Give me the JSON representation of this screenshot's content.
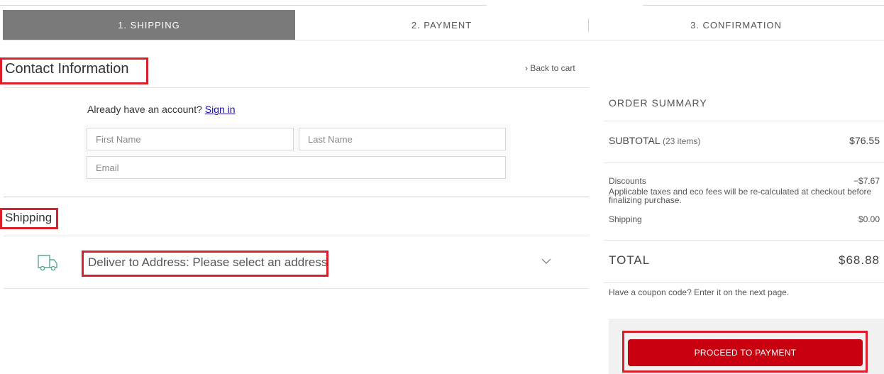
{
  "steps": [
    {
      "label": "1. SHIPPING",
      "active": true
    },
    {
      "label": "2. PAYMENT",
      "active": false
    },
    {
      "label": "3. CONFIRMATION",
      "active": false
    }
  ],
  "contact": {
    "title": "Contact Information",
    "back_link": "› Back to cart",
    "account_prompt": "Already have an account?",
    "sign_in": "Sign in",
    "first_name_placeholder": "First Name",
    "last_name_placeholder": "Last Name",
    "email_placeholder": "Email"
  },
  "shipping": {
    "title": "Shipping",
    "deliver_label": "Deliver to Address: Please select an address",
    "truck_icon": "truck-icon",
    "chevron_icon": "chevron-down-icon"
  },
  "summary": {
    "title": "ORDER SUMMARY",
    "subtotal_label": "SUBTOTAL",
    "subtotal_items": "(23 items)",
    "subtotal_value": "$76.55",
    "discounts_label": "Discounts",
    "discounts_value": "−$7.67",
    "tax_note": "Applicable taxes and eco fees will be re-calculated at checkout before finalizing purchase.",
    "shipping_label": "Shipping",
    "shipping_value": "$0.00",
    "total_label": "TOTAL",
    "total_value": "$68.88",
    "coupon_note": "Have a coupon code? Enter it on the next page.",
    "pay_button": "PROCEED TO PAYMENT"
  },
  "colors": {
    "active_step": "#7a7a7a",
    "primary_button": "#c8000f",
    "highlight": "#d9202a",
    "link": "#1a0dab"
  }
}
